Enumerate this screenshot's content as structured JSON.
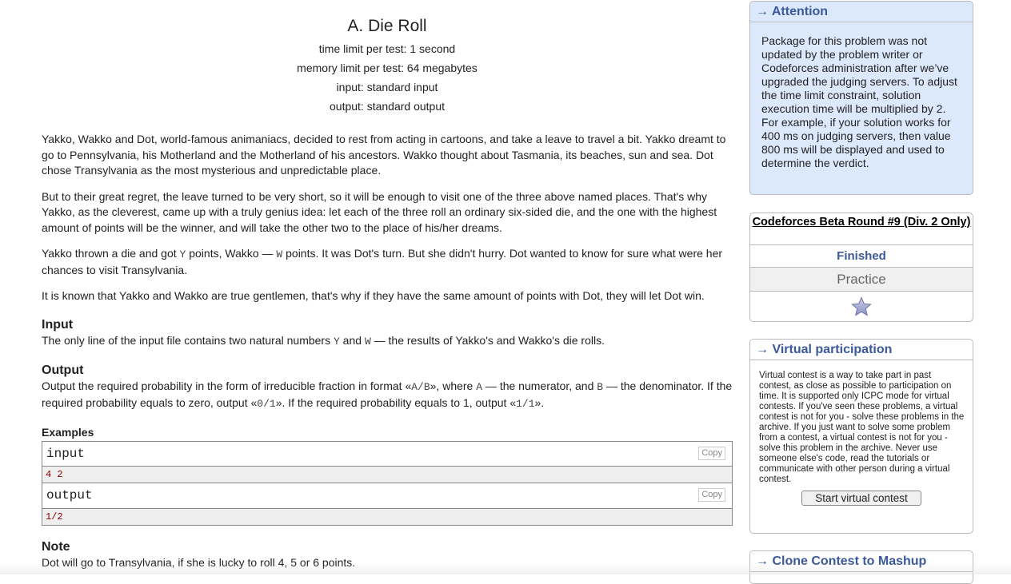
{
  "problem": {
    "title": "A. Die Roll",
    "time_limit": "time limit per test: 1 second",
    "memory_limit": "memory limit per test: 64 megabytes",
    "input_file": "input: standard input",
    "output_file": "output: standard output",
    "statement_p1": "Yakko, Wakko and Dot, world-famous animaniacs, decided to rest from acting in cartoons, and take a leave to travel a bit. Yakko dreamt to go to Pennsylvania, his Motherland and the Motherland of his ancestors. Wakko thought about Tasmania, its beaches, sun and sea. Dot chose Transylvania as the most mysterious and unpredictable place.",
    "statement_p2": "But to their great regret, the leave turned to be very short, so it will be enough to visit one of the three above named places. That's why Yakko, as the cleverest, came up with a truly genius idea: let each of the three roll an ordinary six-sided die, and the one with the highest amount of points will be the winner, and will take the other two to the place of his/her dreams.",
    "statement_p3": {
      "a": "Yakko thrown a die and got ",
      "v1": "Y",
      "b": " points, Wakko — ",
      "v2": "W",
      "c": " points. It was Dot's turn. But she didn't hurry. Dot wanted to know for sure what were her chances to visit Transylvania."
    },
    "statement_p4": "It is known that Yakko and Wakko are true gentlemen, that's why if they have the same amount of points with Dot, they will let Dot win.",
    "input_title": "Input",
    "input_text": {
      "a": "The only line of the input file contains two natural numbers ",
      "v1": "Y",
      "b": " and ",
      "v2": "W",
      "c": " — the results of Yakko's and Wakko's die rolls."
    },
    "output_title": "Output",
    "output_text": {
      "a": "Output the required probability in the form of irreducible fraction in format «",
      "v1": "A/B",
      "b": "», where ",
      "v2": "A",
      "c": " — the numerator, and ",
      "v3": "B",
      "d": " — the denominator. If the required probability equals to zero, output «",
      "v4": "0/1",
      "e": "». If the required probability equals to 1, output «",
      "v5": "1/1",
      "f": "»."
    },
    "examples_title": "Examples",
    "example_input_label": "input",
    "example_input_value": "4 2",
    "example_output_label": "output",
    "example_output_value": "1/2",
    "copy_label": "Copy",
    "note_title": "Note",
    "note_text": "Dot will go to Transylvania, if she is lucky to roll 4, 5 or 6 points."
  },
  "sidebar": {
    "attention_title": "→ Attention",
    "attention_text": "Package for this problem was not updated by the problem writer or Codeforces administration after we’ve upgraded the judging servers. To adjust the time limit constraint, solution execution time will be multiplied by 2. For example, if your solution works for 400 ms on judging servers, then value 800 ms will be displayed and used to determine the verdict.",
    "contest_name": "Codeforces Beta Round #9 (Div. 2 Only)",
    "contest_status": "Finished",
    "contest_mode": "Practice",
    "star_icon": "star-icon",
    "virtual_title": "→ Virtual participation",
    "virtual_text": "Virtual contest is a way to take part in past contest, as close as possible to participation on time. It is supported only ICPC mode for virtual contests. If you've seen these problems, a virtual contest is not for you - solve these problems in the archive. If you just want to solve some problem from a contest, a virtual contest is not for you - solve this problem in the archive. Never use someone else's code, read the tutorials or communicate with other person during a virtual contest.",
    "virtual_button": "Start virtual contest",
    "clone_title": "→ Clone Contest to Mashup"
  },
  "colors": {
    "accent": "#3b5998",
    "attention_bg": "#dce8fc",
    "example_value": "#8b0000"
  }
}
